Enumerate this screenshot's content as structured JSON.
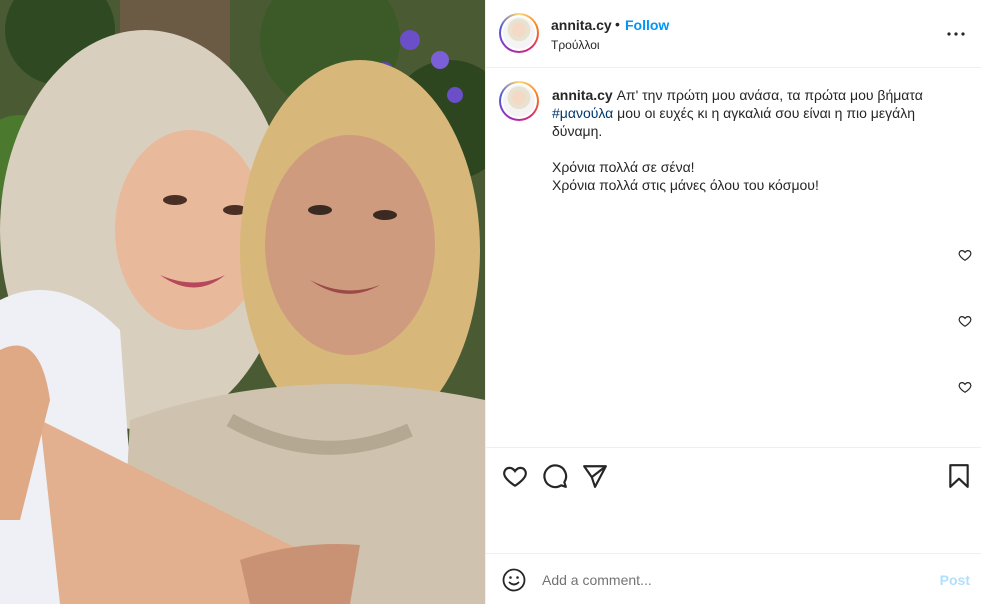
{
  "post": {
    "username": "annita.cy",
    "separator": "•",
    "follow_label": "Follow",
    "location": "Τρούλλοι",
    "caption_username": "annita.cy",
    "caption_line1": " Απ' την πρώτη μου ανάσα, τα πρώτα μου βήματα ",
    "hashtag": "#μανούλα",
    "caption_line2": " μου οι ευχές κι η αγκαλιά σου είναι η πιο μεγάλη δύναμη.",
    "caption_line3": "Χρόνια πολλά σε σένα!",
    "caption_line4": "Χρόνια πολλά στις μάνες όλου του κόσμου!"
  },
  "icons": {
    "more": "more-options-icon",
    "like": "heart-icon",
    "comment": "comment-icon",
    "share": "paper-plane-icon",
    "save": "bookmark-icon",
    "emoji": "emoji-icon"
  },
  "comment_box": {
    "placeholder": "Add a comment...",
    "post_label": "Post"
  },
  "colors": {
    "accent": "#0095f6",
    "hashtag": "#00376b",
    "post_disabled": "#b2dffc",
    "text": "#262626"
  }
}
